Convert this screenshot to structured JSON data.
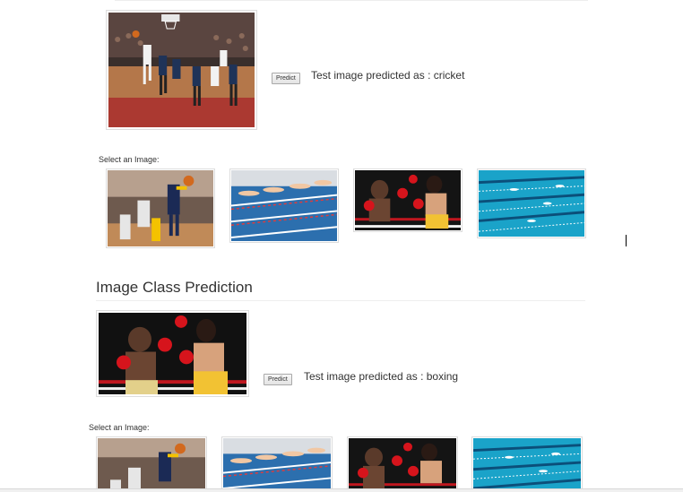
{
  "sections": [
    {
      "heading": "",
      "test_image": "basketball-dunk-photo",
      "predict_label": "Predict",
      "result_text": "Test image predicted as : cricket",
      "select_label": "Select an Image:",
      "thumbnails": [
        "basketball-photo",
        "swimmers-diving-photo",
        "boxing-punch-photo",
        "swimming-pool-photo"
      ]
    },
    {
      "heading": "Image Class Prediction",
      "test_image": "boxing-punch-photo",
      "predict_label": "Predict",
      "result_text": "Test image predicted as : boxing",
      "select_label": "Select an Image:",
      "thumbnails": [
        "basketball-photo",
        "swimmers-diving-photo",
        "boxing-punch-photo",
        "swimming-pool-photo"
      ]
    }
  ],
  "colors": {
    "text": "#333333",
    "rule": "#eeeeee",
    "pool": "#1aa3c9",
    "court": "#b4774a",
    "ring_red": "#c0171f"
  }
}
